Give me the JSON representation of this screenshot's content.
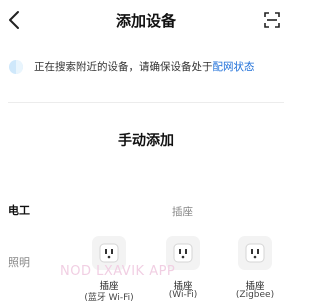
{
  "header": {
    "title": "添加设备",
    "back_icon": "back-arrow-icon",
    "scan_icon": "scan-icon"
  },
  "tip": {
    "icon": "searching-indicator-icon",
    "text": "正在搜索附近的设备，请确保设备处于",
    "link": "配网状态",
    "link_color": "#1e6fd9"
  },
  "manual": {
    "title": "手动添加",
    "categories": [
      {
        "label": "电工",
        "active": true
      },
      {
        "label": "照明",
        "active": false
      }
    ],
    "group_label": "插座",
    "devices": [
      {
        "name": "插座",
        "sub": "(蓝牙 Wi-Fi)"
      },
      {
        "name": "插座",
        "sub": "(Wi-Fi)"
      },
      {
        "name": "插座",
        "sub": "(Zigbee)"
      }
    ]
  },
  "watermark": "NOD LXAVIK APP"
}
